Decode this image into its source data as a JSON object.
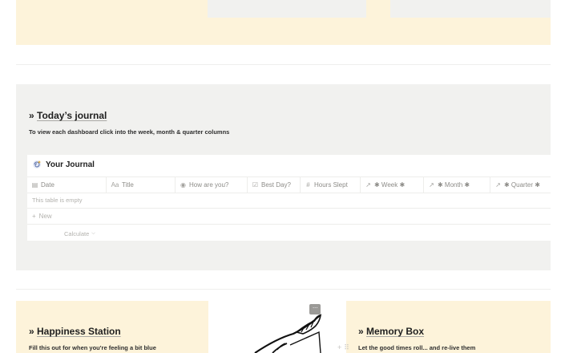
{
  "journal": {
    "title_prefix": "» ",
    "title": "Today’s journal",
    "subtitle": "To view each dashboard click into the week, month & quarter columns"
  },
  "database": {
    "title": "Your Journal",
    "icon": "sparkle-spiral-icon",
    "columns": [
      {
        "label": "Date",
        "icon": "calendar-icon",
        "glyph": "▤"
      },
      {
        "label": "Title",
        "icon": "text-aa-icon",
        "glyph": "Aa"
      },
      {
        "label": "How are you?",
        "icon": "select-circle-icon",
        "glyph": "◉"
      },
      {
        "label": "Best Day?",
        "icon": "checkbox-icon",
        "glyph": "☑"
      },
      {
        "label": "Hours Slept",
        "icon": "number-hash-icon",
        "glyph": "#"
      },
      {
        "label": "✱ Week ✱",
        "icon": "relation-arrow-icon",
        "glyph": "↗"
      },
      {
        "label": "✱ Month ✱",
        "icon": "relation-arrow-icon",
        "glyph": "↗"
      },
      {
        "label": "✱ Quarter ✱",
        "icon": "relation-arrow-icon",
        "glyph": "↗"
      }
    ],
    "empty_text": "This table is empty",
    "new_label": "New",
    "calculate_label": "Calculate"
  },
  "happiness": {
    "title_prefix": "» ",
    "title": "Happiness Station",
    "subtitle": "Fill this out for when you're feeling a bit blue"
  },
  "memory": {
    "title_prefix": "» ",
    "title": "Memory Box",
    "subtitle": "Let the good times roll... and re-live them"
  },
  "colors": {
    "cream": "#fdf3da",
    "gray_panel": "#f1f1ef",
    "text": "#37352f"
  }
}
